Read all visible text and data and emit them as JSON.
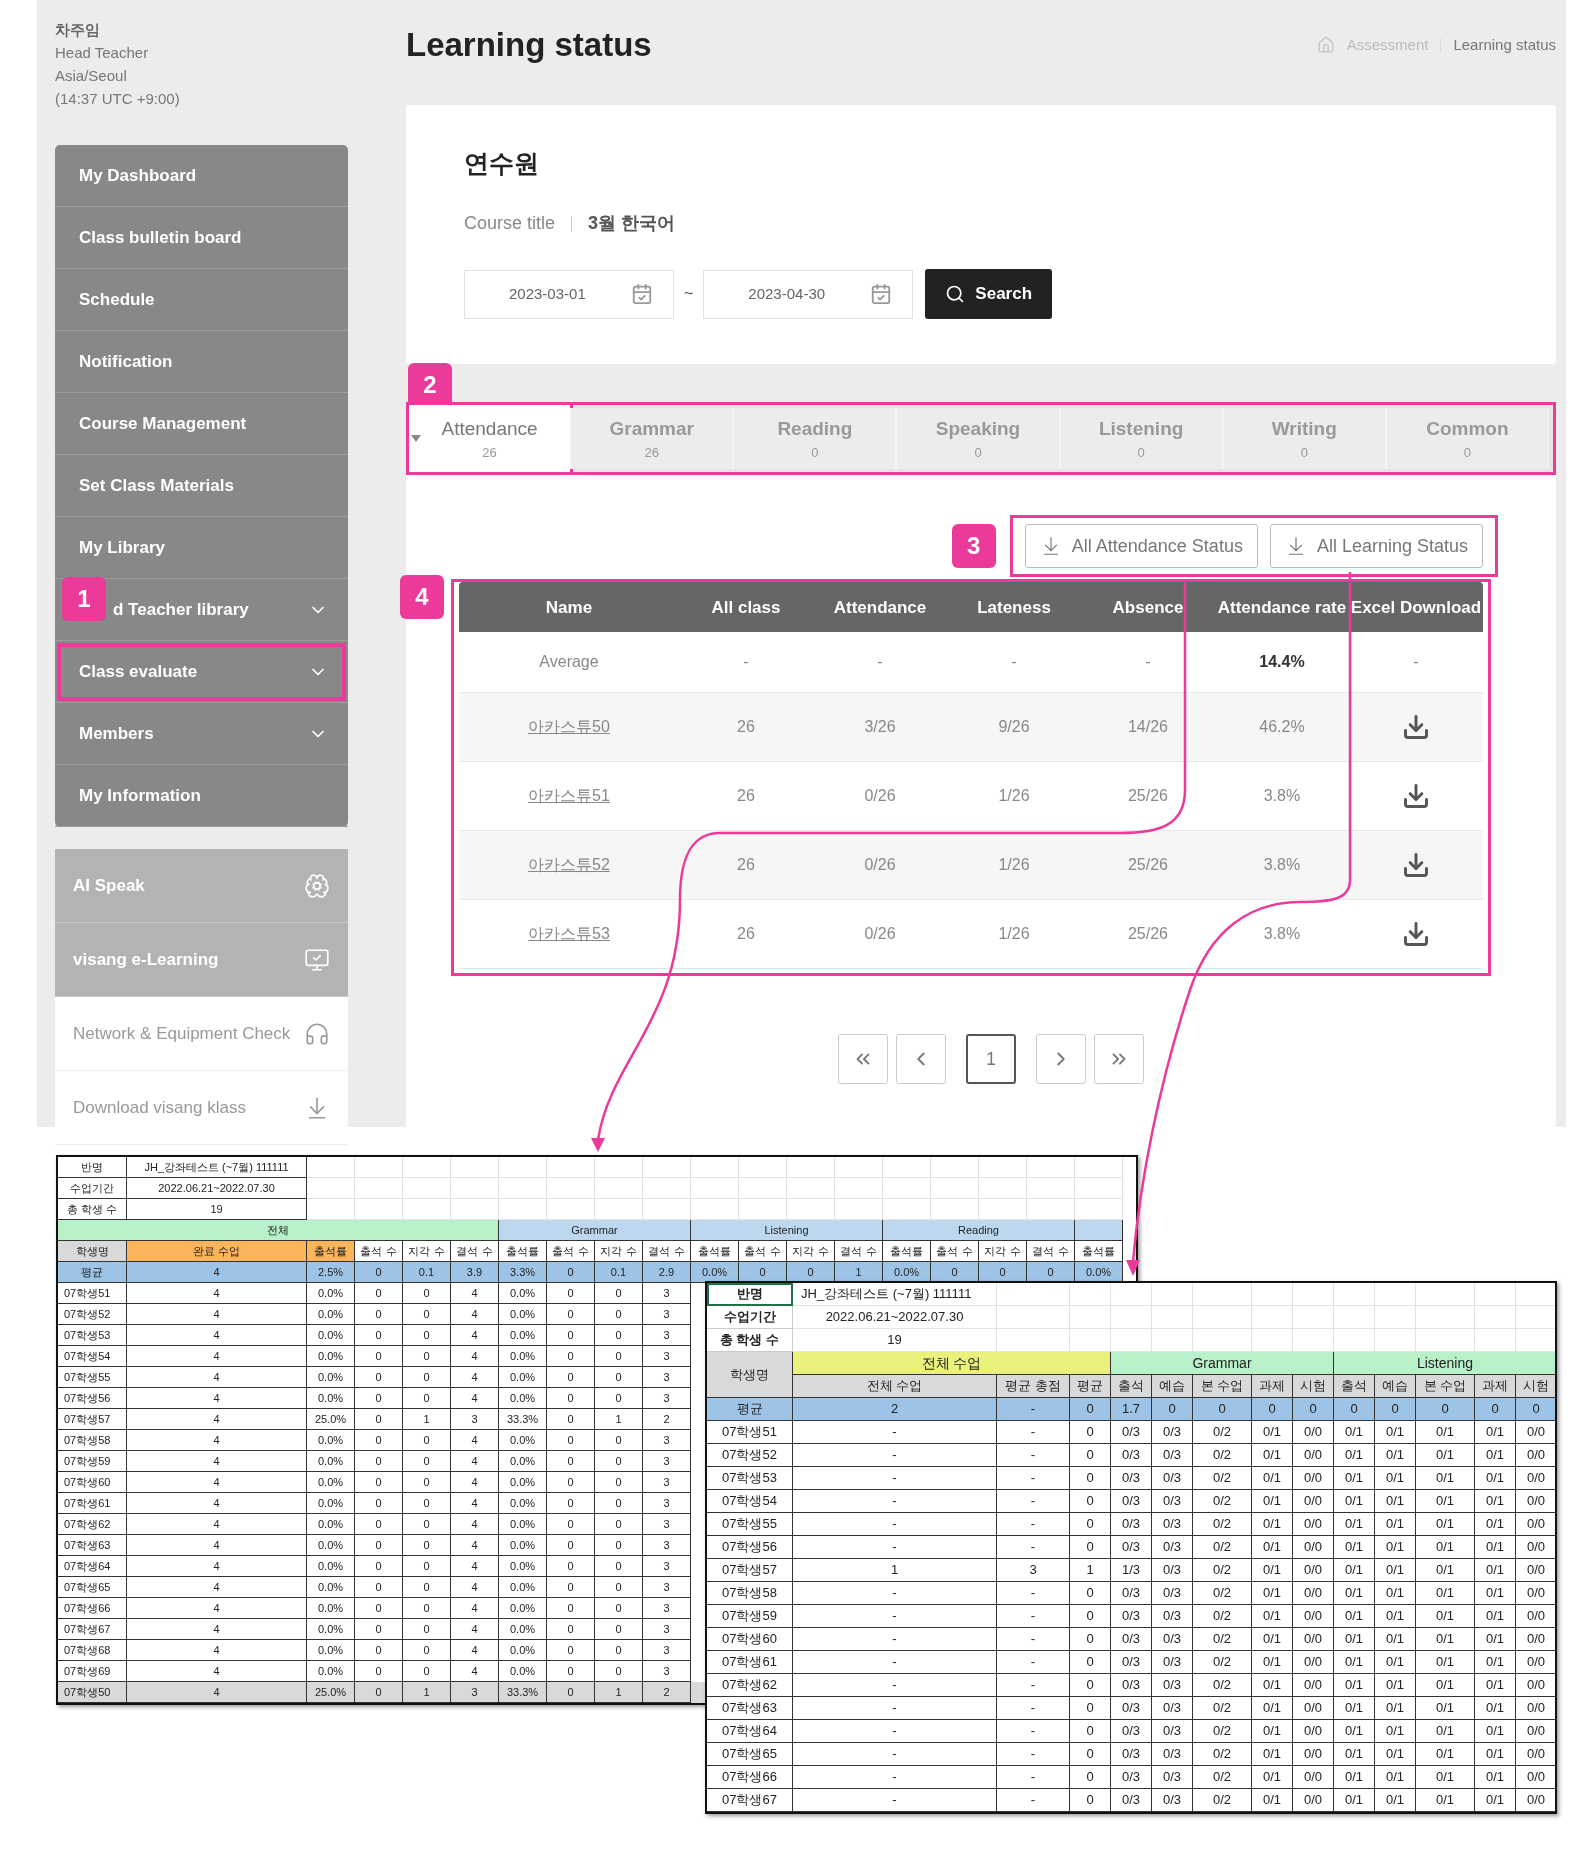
{
  "profile": {
    "name": "차주임",
    "role": "Head Teacher",
    "timezone": "Asia/Seoul",
    "time": "(14:37 UTC +9:00)"
  },
  "sidebar": {
    "items": [
      {
        "label": "My Dashboard",
        "expandable": false,
        "highlighted": false
      },
      {
        "label": "Class bulletin board",
        "expandable": false,
        "highlighted": false
      },
      {
        "label": "Schedule",
        "expandable": false,
        "highlighted": false
      },
      {
        "label": "Notification",
        "expandable": false,
        "highlighted": false
      },
      {
        "label": "Course Management",
        "expandable": false,
        "highlighted": false
      },
      {
        "label": "Set Class Materials",
        "expandable": false,
        "highlighted": false
      },
      {
        "label": "My Library",
        "expandable": false,
        "highlighted": false
      },
      {
        "label": "d Teacher library",
        "expandable": true,
        "highlighted": false,
        "badge": "1"
      },
      {
        "label": "Class evaluate",
        "expandable": true,
        "highlighted": true
      },
      {
        "label": "Members",
        "expandable": true,
        "highlighted": false
      },
      {
        "label": "My Information",
        "expandable": false,
        "highlighted": false
      }
    ],
    "links": [
      {
        "label": "AI Speak",
        "kind": "dark"
      },
      {
        "label": "visang e-Learning",
        "kind": "dark"
      },
      {
        "label": "Network & Equipment Check",
        "kind": "light"
      },
      {
        "label": "Download visang klass",
        "kind": "light"
      }
    ]
  },
  "page_title": "Learning status",
  "breadcrumb": [
    "Assessment",
    "Learning status"
  ],
  "search_card": {
    "title": "연수원",
    "course_label": "Course title",
    "course_value": "3월 한국어",
    "start_date": "2023-03-01",
    "separator": "~",
    "end_date": "2023-04-30",
    "button": "Search"
  },
  "tabs": {
    "badge": "2",
    "items": [
      {
        "label": "Attendance",
        "count": "26",
        "selected": true
      },
      {
        "label": "Grammar",
        "count": "26",
        "selected": false
      },
      {
        "label": "Reading",
        "count": "0",
        "selected": false
      },
      {
        "label": "Speaking",
        "count": "0",
        "selected": false
      },
      {
        "label": "Listening",
        "count": "0",
        "selected": false
      },
      {
        "label": "Writing",
        "count": "0",
        "selected": false
      },
      {
        "label": "Common",
        "count": "0",
        "selected": false
      }
    ]
  },
  "downloads": {
    "badge": "3",
    "buttons": [
      "All Attendance Status",
      "All Learning Status"
    ]
  },
  "table": {
    "badge": "4",
    "columns": [
      "Name",
      "All class",
      "Attendance",
      "Lateness",
      "Absence",
      "Attendance rate",
      "Excel Download"
    ],
    "rows": [
      {
        "kind": "average",
        "cells": [
          "Average",
          "-",
          "-",
          "-",
          "-",
          "14.4%",
          "-"
        ]
      },
      {
        "kind": "student",
        "cells": [
          "아카스튜50",
          "26",
          "3/26",
          "9/26",
          "14/26",
          "46.2%"
        ]
      },
      {
        "kind": "student",
        "cells": [
          "아카스튜51",
          "26",
          "0/26",
          "1/26",
          "25/26",
          "3.8%"
        ]
      },
      {
        "kind": "student",
        "cells": [
          "아카스튜52",
          "26",
          "0/26",
          "1/26",
          "25/26",
          "3.8%"
        ]
      },
      {
        "kind": "student",
        "cells": [
          "아카스튜53",
          "26",
          "0/26",
          "1/26",
          "25/26",
          "3.8%"
        ]
      }
    ]
  },
  "pagination": {
    "pages": [
      {
        "label": "1",
        "selected": true
      }
    ]
  },
  "sheet_1": {
    "info": [
      {
        "label": "반명",
        "value": "JH_강좌테스트 (~7월) 111111"
      },
      {
        "label": "수업기간",
        "value": "2022.06.21~2022.07.30"
      },
      {
        "label": "총 학생 수",
        "value": "19"
      }
    ],
    "groups": [
      {
        "label": "전체",
        "color": "#b7f0c9"
      },
      {
        "label": "Grammar",
        "color": "#bdd7ee"
      },
      {
        "label": "Listening",
        "color": "#bdd7ee"
      },
      {
        "label": "Reading",
        "color": "#bdd7ee"
      },
      {
        "color": "#bdd7ee"
      }
    ],
    "columns": [
      {
        "label": "학생명",
        "color": "#d9d9d9"
      },
      {
        "label": "완료 수업",
        "color": "#fbb45c"
      },
      {
        "label": "출석률",
        "color": "#fbb45c"
      },
      {
        "label": "출석 수",
        "color": "#ffffff"
      },
      {
        "label": "지각 수",
        "color": "#ffffff"
      },
      {
        "label": "결석 수",
        "color": "#ffffff"
      },
      {
        "label": "출석률",
        "color": "#ffffff"
      },
      {
        "label": "출석 수",
        "color": "#ffffff"
      },
      {
        "label": "지각 수",
        "color": "#ffffff"
      },
      {
        "label": "결석 수",
        "color": "#ffffff"
      },
      {
        "label": "출석률",
        "color": "#ffffff"
      },
      {
        "label": "출석 수",
        "color": "#ffffff"
      },
      {
        "label": "지각 수",
        "color": "#ffffff"
      },
      {
        "label": "결석 수",
        "color": "#ffffff"
      },
      {
        "label": "출석률",
        "color": "#ffffff"
      },
      {
        "label": "출석 수",
        "color": "#ffffff"
      },
      {
        "label": "지각 수",
        "color": "#ffffff"
      },
      {
        "label": "결석 수",
        "color": "#ffffff"
      },
      {
        "label": "출석률",
        "color": "#ffffff"
      }
    ],
    "average": [
      "평균",
      "4",
      "2.5%",
      "0",
      "0.1",
      "3.9",
      "3.3%",
      "0",
      "0.1",
      "2.9",
      "0.0%",
      "0",
      "0",
      "1",
      "0.0%",
      "0",
      "0",
      "0",
      "0.0%"
    ],
    "rows": [
      {
        "selected": false,
        "cells": [
          "07학생51",
          "4",
          "0.0%",
          "0",
          "0",
          "4",
          "0.0%",
          "0",
          "0",
          "3"
        ]
      },
      {
        "selected": false,
        "cells": [
          "07학생52",
          "4",
          "0.0%",
          "0",
          "0",
          "4",
          "0.0%",
          "0",
          "0",
          "3"
        ]
      },
      {
        "selected": false,
        "cells": [
          "07학생53",
          "4",
          "0.0%",
          "0",
          "0",
          "4",
          "0.0%",
          "0",
          "0",
          "3"
        ]
      },
      {
        "selected": false,
        "cells": [
          "07학생54",
          "4",
          "0.0%",
          "0",
          "0",
          "4",
          "0.0%",
          "0",
          "0",
          "3"
        ]
      },
      {
        "selected": false,
        "cells": [
          "07학생55",
          "4",
          "0.0%",
          "0",
          "0",
          "4",
          "0.0%",
          "0",
          "0",
          "3"
        ]
      },
      {
        "selected": false,
        "cells": [
          "07학생56",
          "4",
          "0.0%",
          "0",
          "0",
          "4",
          "0.0%",
          "0",
          "0",
          "3"
        ]
      },
      {
        "selected": false,
        "cells": [
          "07학생57",
          "4",
          "25.0%",
          "0",
          "1",
          "3",
          "33.3%",
          "0",
          "1",
          "2"
        ]
      },
      {
        "selected": false,
        "cells": [
          "07학생58",
          "4",
          "0.0%",
          "0",
          "0",
          "4",
          "0.0%",
          "0",
          "0",
          "3"
        ]
      },
      {
        "selected": false,
        "cells": [
          "07학생59",
          "4",
          "0.0%",
          "0",
          "0",
          "4",
          "0.0%",
          "0",
          "0",
          "3"
        ]
      },
      {
        "selected": false,
        "cells": [
          "07학생60",
          "4",
          "0.0%",
          "0",
          "0",
          "4",
          "0.0%",
          "0",
          "0",
          "3"
        ]
      },
      {
        "selected": false,
        "cells": [
          "07학생61",
          "4",
          "0.0%",
          "0",
          "0",
          "4",
          "0.0%",
          "0",
          "0",
          "3"
        ]
      },
      {
        "selected": false,
        "cells": [
          "07학생62",
          "4",
          "0.0%",
          "0",
          "0",
          "4",
          "0.0%",
          "0",
          "0",
          "3"
        ]
      },
      {
        "selected": false,
        "cells": [
          "07학생63",
          "4",
          "0.0%",
          "0",
          "0",
          "4",
          "0.0%",
          "0",
          "0",
          "3"
        ]
      },
      {
        "selected": false,
        "cells": [
          "07학생64",
          "4",
          "0.0%",
          "0",
          "0",
          "4",
          "0.0%",
          "0",
          "0",
          "3"
        ]
      },
      {
        "selected": false,
        "cells": [
          "07학생65",
          "4",
          "0.0%",
          "0",
          "0",
          "4",
          "0.0%",
          "0",
          "0",
          "3"
        ]
      },
      {
        "selected": false,
        "cells": [
          "07학생66",
          "4",
          "0.0%",
          "0",
          "0",
          "4",
          "0.0%",
          "0",
          "0",
          "3"
        ]
      },
      {
        "selected": false,
        "cells": [
          "07학생67",
          "4",
          "0.0%",
          "0",
          "0",
          "4",
          "0.0%",
          "0",
          "0",
          "3"
        ]
      },
      {
        "selected": false,
        "cells": [
          "07학생68",
          "4",
          "0.0%",
          "0",
          "0",
          "4",
          "0.0%",
          "0",
          "0",
          "3"
        ]
      },
      {
        "selected": false,
        "cells": [
          "07학생69",
          "4",
          "0.0%",
          "0",
          "0",
          "4",
          "0.0%",
          "0",
          "0",
          "3"
        ]
      },
      {
        "selected": true,
        "cells": [
          "07학생50",
          "4",
          "25.0%",
          "0",
          "1",
          "3",
          "33.3%",
          "0",
          "1",
          "2"
        ]
      }
    ]
  },
  "sheet_2": {
    "info": [
      {
        "label": "반명",
        "value": "JH_강좌테스트 (~7월) 111111"
      },
      {
        "label": "수업기간",
        "value": "2022.06.21~2022.07.30"
      },
      {
        "label": "총 학생 수",
        "value": "19"
      }
    ],
    "groups": [
      {
        "label": "전체 수업",
        "color": "#e9f07c"
      },
      {
        "label": "Grammar",
        "color": "#b7f0c9"
      },
      {
        "label": "Listening",
        "color": "#b7f0c9"
      }
    ],
    "columns": [
      "학생명",
      "전체 수업",
      "평균 총점",
      "평균",
      "출석",
      "예습",
      "본 수업",
      "과제",
      "시험",
      "출석",
      "예습",
      "본 수업",
      "과제",
      "시험"
    ],
    "average": [
      "평균",
      "2",
      "-",
      "0",
      "1.7",
      "0",
      "0",
      "0",
      "0",
      "0",
      "0",
      "0",
      "0",
      "0"
    ],
    "rows": [
      [
        "07학생51",
        "-",
        "-",
        "0",
        "0/3",
        "0/3",
        "0/2",
        "0/1",
        "0/0",
        "0/1",
        "0/1",
        "0/1",
        "0/1",
        "0/0"
      ],
      [
        "07학생52",
        "-",
        "-",
        "0",
        "0/3",
        "0/3",
        "0/2",
        "0/1",
        "0/0",
        "0/1",
        "0/1",
        "0/1",
        "0/1",
        "0/0"
      ],
      [
        "07학생53",
        "-",
        "-",
        "0",
        "0/3",
        "0/3",
        "0/2",
        "0/1",
        "0/0",
        "0/1",
        "0/1",
        "0/1",
        "0/1",
        "0/0"
      ],
      [
        "07학생54",
        "-",
        "-",
        "0",
        "0/3",
        "0/3",
        "0/2",
        "0/1",
        "0/0",
        "0/1",
        "0/1",
        "0/1",
        "0/1",
        "0/0"
      ],
      [
        "07학생55",
        "-",
        "-",
        "0",
        "0/3",
        "0/3",
        "0/2",
        "0/1",
        "0/0",
        "0/1",
        "0/1",
        "0/1",
        "0/1",
        "0/0"
      ],
      [
        "07학생56",
        "-",
        "-",
        "0",
        "0/3",
        "0/3",
        "0/2",
        "0/1",
        "0/0",
        "0/1",
        "0/1",
        "0/1",
        "0/1",
        "0/0"
      ],
      [
        "07학생57",
        "1",
        "3",
        "1",
        "1/3",
        "0/3",
        "0/2",
        "0/1",
        "0/0",
        "0/1",
        "0/1",
        "0/1",
        "0/1",
        "0/0"
      ],
      [
        "07학생58",
        "-",
        "-",
        "0",
        "0/3",
        "0/3",
        "0/2",
        "0/1",
        "0/0",
        "0/1",
        "0/1",
        "0/1",
        "0/1",
        "0/0"
      ],
      [
        "07학생59",
        "-",
        "-",
        "0",
        "0/3",
        "0/3",
        "0/2",
        "0/1",
        "0/0",
        "0/1",
        "0/1",
        "0/1",
        "0/1",
        "0/0"
      ],
      [
        "07학생60",
        "-",
        "-",
        "0",
        "0/3",
        "0/3",
        "0/2",
        "0/1",
        "0/0",
        "0/1",
        "0/1",
        "0/1",
        "0/1",
        "0/0"
      ],
      [
        "07학생61",
        "-",
        "-",
        "0",
        "0/3",
        "0/3",
        "0/2",
        "0/1",
        "0/0",
        "0/1",
        "0/1",
        "0/1",
        "0/1",
        "0/0"
      ],
      [
        "07학생62",
        "-",
        "-",
        "0",
        "0/3",
        "0/3",
        "0/2",
        "0/1",
        "0/0",
        "0/1",
        "0/1",
        "0/1",
        "0/1",
        "0/0"
      ],
      [
        "07학생63",
        "-",
        "-",
        "0",
        "0/3",
        "0/3",
        "0/2",
        "0/1",
        "0/0",
        "0/1",
        "0/1",
        "0/1",
        "0/1",
        "0/0"
      ],
      [
        "07학생64",
        "-",
        "-",
        "0",
        "0/3",
        "0/3",
        "0/2",
        "0/1",
        "0/0",
        "0/1",
        "0/1",
        "0/1",
        "0/1",
        "0/0"
      ],
      [
        "07학생65",
        "-",
        "-",
        "0",
        "0/3",
        "0/3",
        "0/2",
        "0/1",
        "0/0",
        "0/1",
        "0/1",
        "0/1",
        "0/1",
        "0/0"
      ],
      [
        "07학생66",
        "-",
        "-",
        "0",
        "0/3",
        "0/3",
        "0/2",
        "0/1",
        "0/0",
        "0/1",
        "0/1",
        "0/1",
        "0/1",
        "0/0"
      ],
      [
        "07학생67",
        "-",
        "-",
        "0",
        "0/3",
        "0/3",
        "0/2",
        "0/1",
        "0/0",
        "0/1",
        "0/1",
        "0/1",
        "0/1",
        "0/0"
      ]
    ]
  }
}
